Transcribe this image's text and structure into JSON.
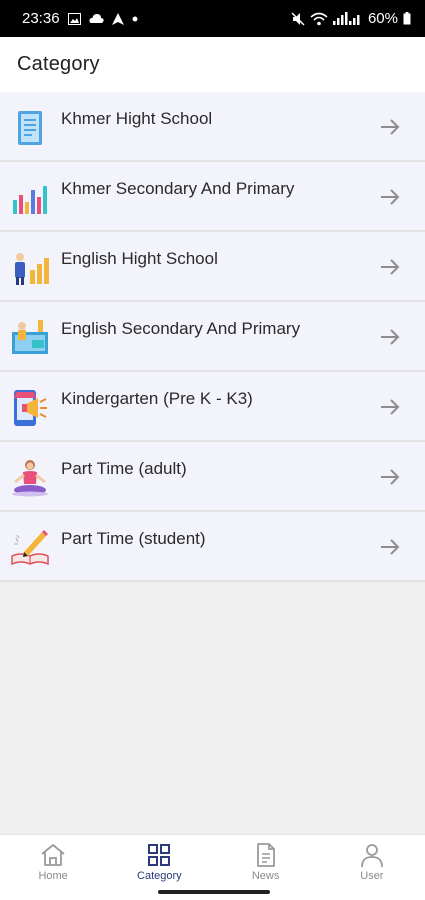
{
  "status_bar": {
    "time": "23:36",
    "battery": "60%"
  },
  "header": {
    "title": "Category"
  },
  "categories": [
    {
      "label": "Khmer Hight School",
      "icon": "book-icon"
    },
    {
      "label": "Khmer Secondary And Primary",
      "icon": "bar-chart-icon"
    },
    {
      "label": "English Hight School",
      "icon": "growth-chart-person-icon"
    },
    {
      "label": "English Secondary And Primary",
      "icon": "classroom-icon"
    },
    {
      "label": "Kindergarten (Pre K - K3)",
      "icon": "phone-megaphone-icon"
    },
    {
      "label": "Part Time (adult)",
      "icon": "yoga-person-icon"
    },
    {
      "label": "Part Time (student)",
      "icon": "pencil-book-icon"
    }
  ],
  "bottom_nav": [
    {
      "label": "Home",
      "icon": "home-icon"
    },
    {
      "label": "Category",
      "icon": "grid-icon",
      "active": true
    },
    {
      "label": "News",
      "icon": "document-icon"
    },
    {
      "label": "User",
      "icon": "user-icon"
    }
  ],
  "colors": {
    "active": "#2a3a7a",
    "inactive": "#8a8a8a",
    "row_bg": "#f3f4fb"
  }
}
